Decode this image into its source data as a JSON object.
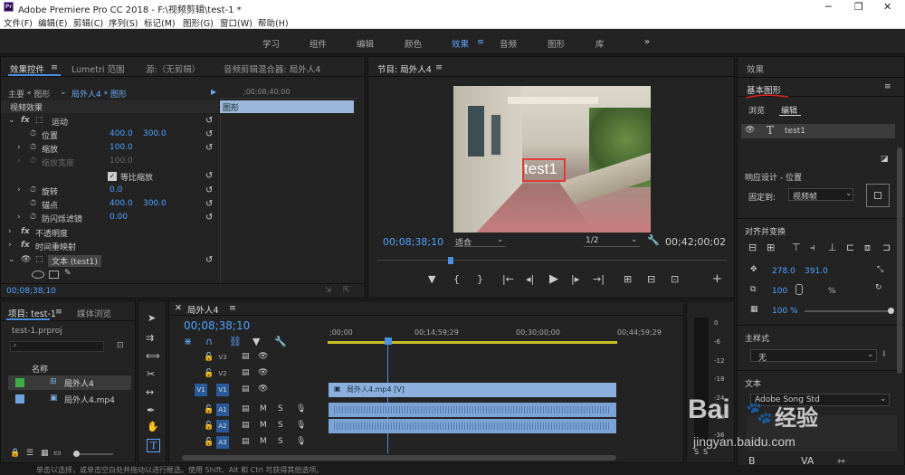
{
  "window": {
    "title": "Adobe Premiere Pro CC 2018 - F:\\视频剪辑\\test-1 *",
    "logo": "Pr"
  },
  "menu": [
    "文件(F)",
    "编辑(E)",
    "剪辑(C)",
    "序列(S)",
    "标记(M)",
    "图形(G)",
    "窗口(W)",
    "帮助(H)"
  ],
  "workspaces": {
    "items": [
      "学习",
      "组件",
      "编辑",
      "颜色",
      "效果",
      "音频",
      "图形",
      "库"
    ],
    "active": "效果",
    "more": "»"
  },
  "effect_controls": {
    "tabs": [
      "效果控件",
      "Lumetri 范围",
      "源:（无剪辑）",
      "音频剪辑混合器: 局外人4"
    ],
    "breadcrumb_master": "主要 * 图形",
    "breadcrumb_clip": "局外人4 * 图形",
    "section": "视频效果",
    "timecode_ruler": ";00;08;40;00",
    "clip_label": "图形",
    "props": {
      "motion": "运动",
      "position": "位置",
      "position_x": "400.0",
      "position_y": "300.0",
      "scale": "缩放",
      "scale_val": "100.0",
      "scale_width": "缩放宽度",
      "scale_width_val": "100.0",
      "uniform_scale": "等比缩放",
      "rotation": "旋转",
      "rotation_val": "0.0",
      "anchor": "锚点",
      "anchor_x": "400.0",
      "anchor_y": "300.0",
      "anti_flicker": "防闪烁滤镜",
      "anti_flicker_val": "0.00",
      "opacity": "不透明度",
      "time_remap": "时间重映射",
      "text_layer": "文本 (test1)"
    },
    "timecode": "00;08;38;10"
  },
  "program_monitor": {
    "title": "节目: 局外人4",
    "overlay_text": "test1",
    "timecode": "00;08;38;10",
    "fit": "适合",
    "resolution": "1/2",
    "duration": "00;42;00;02"
  },
  "project": {
    "tabs": [
      "项目: test-1",
      "媒体浏览"
    ],
    "file": "test-1.prproj",
    "column_name": "名称",
    "items": [
      {
        "name": "局外人4",
        "color": "#3fae49"
      },
      {
        "name": "局外人4.mp4",
        "color": "#6fa5de"
      }
    ]
  },
  "timeline": {
    "tab": "局外人4",
    "timecode": "00;08;38;10",
    "ruler": [
      ";00;00",
      "00;14;59;29",
      "00;30;00;00",
      "00;44;59;29"
    ],
    "video_tracks": [
      "V3",
      "V2",
      "V1"
    ],
    "audio_tracks": [
      "A1",
      "A2",
      "A3"
    ],
    "clip_video": "局外人4.mp4 [V]",
    "meter_labels": [
      "0",
      "-6",
      "-12",
      "-18",
      "-24",
      "-30",
      "-36"
    ]
  },
  "essential_graphics": {
    "panel_title": "效果",
    "title": "基本图形",
    "tabs": [
      "浏览",
      "编辑"
    ],
    "active_tab": "编辑",
    "layer": "test1",
    "responsive": "响应设计 - 位置",
    "pin_label": "固定到:",
    "pin_value": "视频帧",
    "align": "对齐并变换",
    "pos_x": "278.0",
    "pos_y": "391.0",
    "scale_val": "100",
    "pct1": "%",
    "opacity": "100 %",
    "master": "主样式",
    "master_value": "无",
    "text": "文本",
    "font": "Adobe Song Std"
  },
  "status": "单击以选择，或单击空白处并拖动以进行框选。使用 Shift、Alt 和 Ctrl 可获得其他选项。",
  "watermark": {
    "brand": "Bai",
    "brand2": "经验",
    "url": "jingyan.baidu.com"
  }
}
